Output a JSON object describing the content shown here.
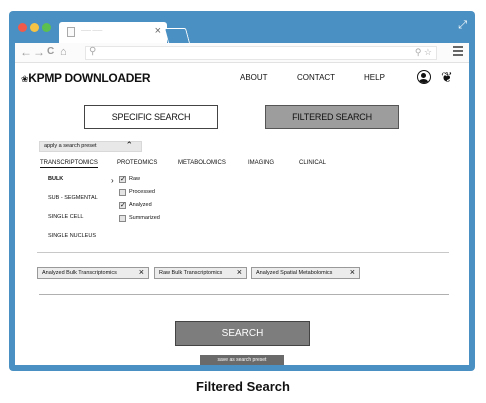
{
  "browser": {
    "tab": {
      "title": "—— ——"
    },
    "window_dots": [
      "#ef5a4b",
      "#f6c344",
      "#5cc04f"
    ],
    "nav": {
      "back": "←",
      "forward": "→",
      "reload": "C",
      "home": "⌂",
      "search": "⚲"
    },
    "url_icons": "⚲ ☆"
  },
  "app": {
    "logo": {
      "mark": "❀",
      "name": "KPMP DOWNLOADER"
    },
    "nav": [
      "ABOUT",
      "CONTACT",
      "HELP"
    ],
    "search_modes": {
      "specific": "SPECIFIC SEARCH",
      "filtered": "FILTERED SEARCH",
      "active": "filtered"
    },
    "preset": {
      "label": "apply a search preset"
    },
    "categories": [
      "TRANSCRIPTOMICS",
      "PROTEOMICS",
      "METABOLOMICS",
      "IMAGING",
      "CLINICAL"
    ],
    "active_category": "TRANSCRIPTOMICS",
    "subcategories": [
      "BULK",
      "SUB - SEGMENTAL",
      "SINGLE CELL",
      "SINGLE NUCLEUS"
    ],
    "active_subcategory": "BULK",
    "options": [
      {
        "label": "Raw",
        "checked": true
      },
      {
        "label": "Processed",
        "checked": false
      },
      {
        "label": "Analyzed",
        "checked": true
      },
      {
        "label": "Summarized",
        "checked": false
      }
    ],
    "chips": [
      "Analyzed Bulk Transcriptomics",
      "Raw Bulk Transcriptomics",
      "Analyzed Spatial Metabolomics"
    ],
    "search_button": "SEARCH",
    "save_preset_button": "save as search preset"
  },
  "caption": "Filtered Search"
}
